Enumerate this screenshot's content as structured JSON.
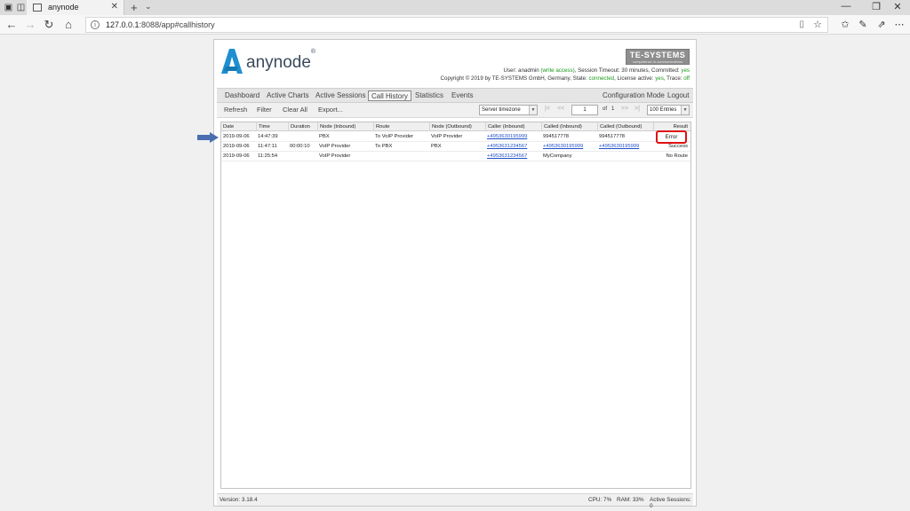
{
  "browser": {
    "tab_title": "anynode",
    "tab_close": "✕",
    "new_tab": "+",
    "tabs_menu": "⌄",
    "url_prefix": "127.0.0.1",
    "url_rest": ":8088/app#callhistory",
    "win_minimize": "—",
    "win_restore": "❐",
    "win_close": "✕",
    "info_glyph": "i"
  },
  "icons": {
    "back": "←",
    "forward": "→",
    "refresh": "↻",
    "home": "⌂",
    "reader": "▯",
    "favorite": "☆",
    "favorites_hub": "✩",
    "notes": "✎",
    "share": "⇗",
    "more": "⋯"
  },
  "header": {
    "logo_text": "anynode",
    "logo_reg": "®",
    "te_brand": "TE-SYSTEMS",
    "te_tagline": "competence in communications",
    "info_line1": {
      "user_prefix": "User: anadmin",
      "user_access": "(write access)",
      "rest": ", Session Timeout: 30 minutes, Committed:",
      "committed": "yes"
    },
    "info_line2": {
      "copyright": "Copyright © 2019 by TE-SYSTEMS GmbH, Germany, State:",
      "state": "connected",
      "license_prefix": ", License active:",
      "license": "yes",
      "trace_prefix": ", Trace:",
      "trace": "off"
    }
  },
  "nav": {
    "dashboard": "Dashboard",
    "active_charts": "Active Charts",
    "active_sessions": "Active Sessions",
    "call_history": "Call History",
    "statistics": "Statistics",
    "events": "Events",
    "configuration_mode": "Configuration Mode",
    "logout": "Logout"
  },
  "toolbar": {
    "refresh": "Refresh",
    "filter": "Filter",
    "clear_all": "Clear All",
    "export": "Export...",
    "timezone": "Server timezone",
    "page_first": "|<",
    "page_prev": "<<",
    "page_current": "1",
    "page_of": "of",
    "page_total": "1",
    "page_next": ">>",
    "page_last": ">|",
    "entries": "100 Entries",
    "dropdown_glyph": "▼"
  },
  "table": {
    "headers": [
      "Date",
      "Time",
      "Duration",
      "Node (Inbound)",
      "Route",
      "Node (Outbound)",
      "Caller (Inbound)",
      "Called (Inbound)",
      "Called (Outbound)",
      "Result"
    ],
    "rows": [
      {
        "date": "2019-09-06",
        "time": "14:47:39",
        "duration": "",
        "node_in": "PBX",
        "route": "To VoIP Provider",
        "node_out": "VoIP Provider",
        "caller_in": "+4953630195999",
        "called_in": "994517778",
        "called_out": "994517778",
        "result": "Error"
      },
      {
        "date": "2019-09-06",
        "time": "11:47:11",
        "duration": "00:00:10",
        "node_in": "VoIP Provider",
        "route": "To PBX",
        "node_out": "PBX",
        "caller_in": "+4953631234567",
        "called_in": "+4953630195999",
        "called_out": "+4953630195999",
        "result": "Success"
      },
      {
        "date": "2019-09-06",
        "time": "11:25:54",
        "duration": "",
        "node_in": "VoIP Provider",
        "route": "",
        "node_out": "",
        "caller_in": "+4953631234567",
        "called_in": "MyCompany",
        "called_out": "",
        "result": "No Route"
      }
    ]
  },
  "footer": {
    "version": "Version: 3.18.4",
    "cpu": "CPU: 7%",
    "ram": "RAM: 33%",
    "active_sessions": "Active Sessions: 0"
  },
  "colors": {
    "accent_link": "#2050c8",
    "status_green": "#1a9a1a",
    "error_highlight": "#e01010",
    "logo_blue": "#1e8fd0"
  }
}
